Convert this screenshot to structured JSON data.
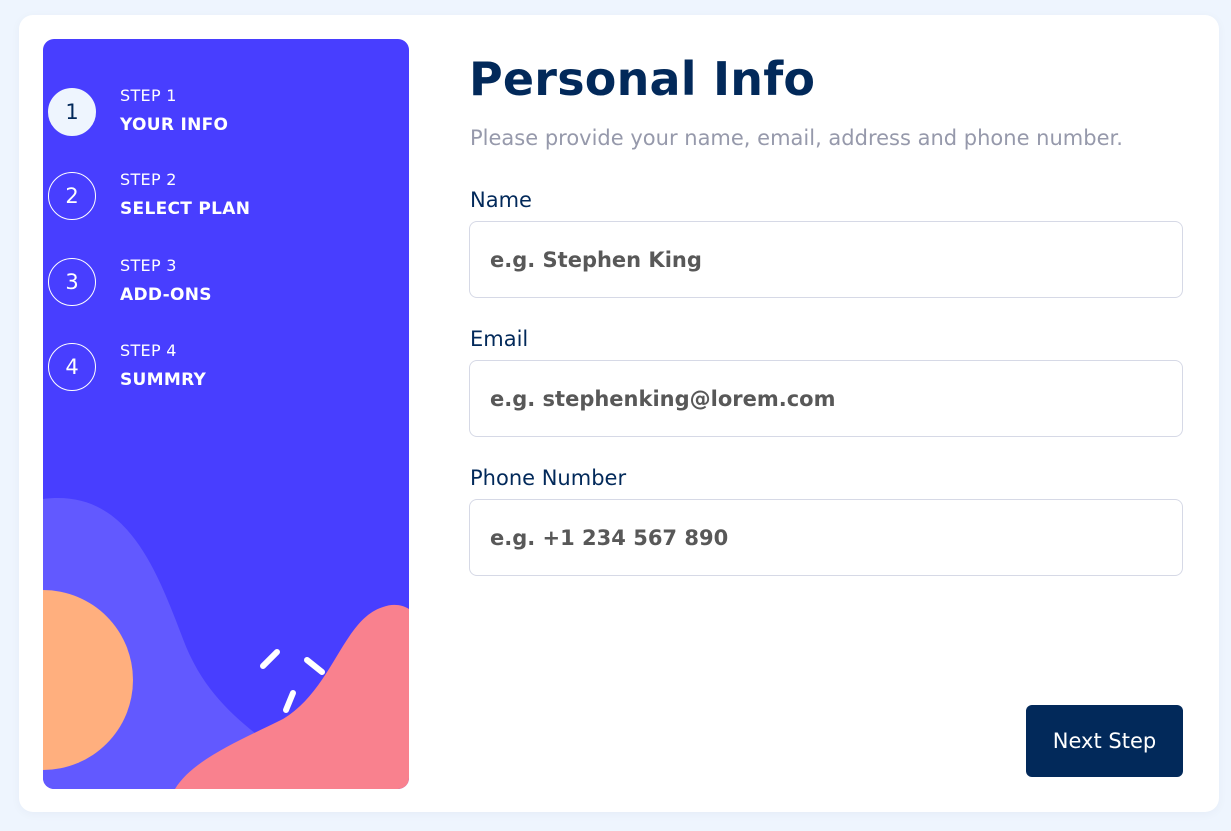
{
  "colors": {
    "marine_blue": "#02295a",
    "purplish_blue": "#483eff",
    "light_blue": "#eef5fe",
    "cool_gray": "#9699ab",
    "light_gray": "#d6d9e6",
    "sidebar_wave": "#6259ff",
    "sidebar_circle": "#ffaf7e",
    "sidebar_blob": "#f9818e"
  },
  "sidebar": {
    "steps": [
      {
        "number": "1",
        "label": "STEP 1",
        "title": "YOUR INFO",
        "active": true
      },
      {
        "number": "2",
        "label": "STEP 2",
        "title": "SELECT PLAN",
        "active": false
      },
      {
        "number": "3",
        "label": "STEP 3",
        "title": "ADD-ONS",
        "active": false
      },
      {
        "number": "4",
        "label": "STEP 4",
        "title": "SUMMRY",
        "active": false
      }
    ]
  },
  "form": {
    "title": "Personal Info",
    "subtitle": "Please provide your name, email, address and phone number.",
    "fields": [
      {
        "label": "Name",
        "placeholder": "e.g. Stephen King",
        "value": ""
      },
      {
        "label": "Email",
        "placeholder": "e.g. stephenking@lorem.com",
        "value": ""
      },
      {
        "label": "Phone Number",
        "placeholder": "e.g. +1 234 567 890",
        "value": ""
      }
    ],
    "next_label": "Next Step"
  }
}
